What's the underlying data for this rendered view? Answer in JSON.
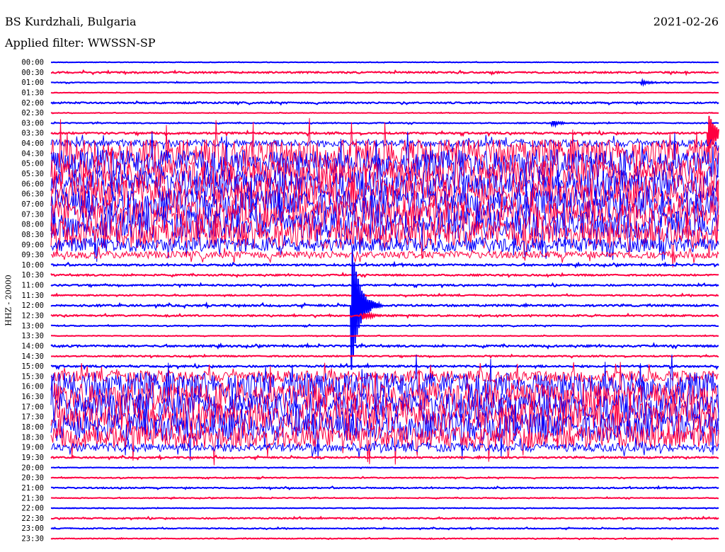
{
  "header": {
    "station": "BS Kurdzhali, Bulgaria",
    "date": "2021-02-26",
    "filter": "Applied filter: WWSSN-SP"
  },
  "chart_data": {
    "type": "line",
    "title": "BS Kurdzhali, Bulgaria",
    "ylabel": "HHZ - 20000",
    "xlabel": "",
    "x_minutes_per_row": 30,
    "colors": {
      "even": "#0000ff",
      "odd": "#ff0040"
    },
    "rows": [
      {
        "label": "00:00",
        "noise": 0.3
      },
      {
        "label": "00:30",
        "noise": 1
      },
      {
        "label": "01:00",
        "noise": 0.5,
        "events": [
          {
            "minute": 26.5,
            "amp": 3
          }
        ]
      },
      {
        "label": "01:30",
        "noise": 0.3
      },
      {
        "label": "02:00",
        "noise": 1
      },
      {
        "label": "02:30",
        "noise": 0.3
      },
      {
        "label": "03:00",
        "noise": 0.6,
        "events": [
          {
            "minute": 22.5,
            "amp": 3
          }
        ]
      },
      {
        "label": "03:30",
        "noise": 1.2,
        "events": [
          {
            "minute": 29.5,
            "amp": 30
          }
        ]
      },
      {
        "label": "04:00",
        "noise": 5
      },
      {
        "label": "04:30",
        "noise": 20
      },
      {
        "label": "05:00",
        "noise": 20
      },
      {
        "label": "05:30",
        "noise": 20
      },
      {
        "label": "06:00",
        "noise": 20
      },
      {
        "label": "06:30",
        "noise": 20
      },
      {
        "label": "07:00",
        "noise": 20
      },
      {
        "label": "07:30",
        "noise": 20
      },
      {
        "label": "08:00",
        "noise": 20
      },
      {
        "label": "08:30",
        "noise": 20
      },
      {
        "label": "09:00",
        "noise": 10
      },
      {
        "label": "09:30",
        "noise": 5
      },
      {
        "label": "10:00",
        "noise": 1.2
      },
      {
        "label": "10:30",
        "noise": 1
      },
      {
        "label": "11:00",
        "noise": 1
      },
      {
        "label": "11:30",
        "noise": 0.8
      },
      {
        "label": "12:00",
        "noise": 1.2,
        "events": [
          {
            "minute": 13.5,
            "amp": 90
          }
        ]
      },
      {
        "label": "12:30",
        "noise": 1,
        "events": [
          {
            "minute": 14,
            "amp": 5
          }
        ]
      },
      {
        "label": "13:00",
        "noise": 0.6
      },
      {
        "label": "13:30",
        "noise": 0.4
      },
      {
        "label": "14:00",
        "noise": 1.2
      },
      {
        "label": "14:30",
        "noise": 0.8
      },
      {
        "label": "15:00",
        "noise": 1.2
      },
      {
        "label": "15:30",
        "noise": 8
      },
      {
        "label": "16:00",
        "noise": 20
      },
      {
        "label": "16:30",
        "noise": 20
      },
      {
        "label": "17:00",
        "noise": 20
      },
      {
        "label": "17:30",
        "noise": 20
      },
      {
        "label": "18:00",
        "noise": 20
      },
      {
        "label": "18:30",
        "noise": 16
      },
      {
        "label": "19:00",
        "noise": 6
      },
      {
        "label": "19:30",
        "noise": 1
      },
      {
        "label": "20:00",
        "noise": 0.4
      },
      {
        "label": "20:30",
        "noise": 0.6
      },
      {
        "label": "21:00",
        "noise": 0.8
      },
      {
        "label": "21:30",
        "noise": 0.5
      },
      {
        "label": "22:00",
        "noise": 0.4
      },
      {
        "label": "22:30",
        "noise": 0.8
      },
      {
        "label": "23:00",
        "noise": 0.6
      },
      {
        "label": "23:30",
        "noise": 0.5
      }
    ]
  }
}
